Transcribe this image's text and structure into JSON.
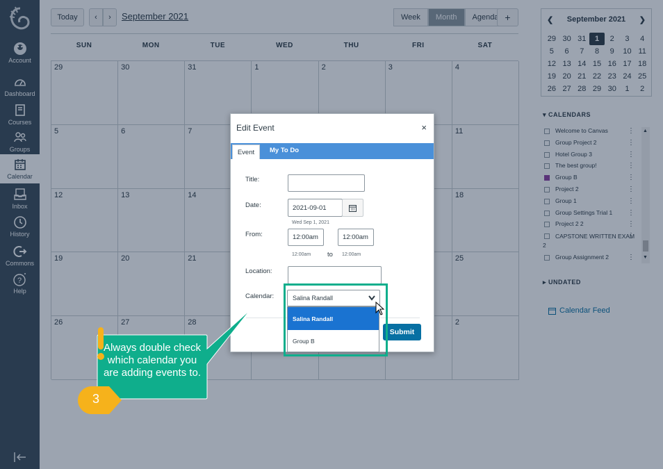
{
  "nav": {
    "items": [
      {
        "label": "Account",
        "icon": "account-icon"
      },
      {
        "label": "Dashboard",
        "icon": "dashboard-icon"
      },
      {
        "label": "Courses",
        "icon": "courses-icon"
      },
      {
        "label": "Groups",
        "icon": "groups-icon"
      },
      {
        "label": "Calendar",
        "icon": "calendar-icon"
      },
      {
        "label": "Inbox",
        "icon": "inbox-icon"
      },
      {
        "label": "History",
        "icon": "history-icon"
      },
      {
        "label": "Commons",
        "icon": "commons-icon"
      },
      {
        "label": "Help",
        "icon": "help-icon"
      }
    ]
  },
  "header": {
    "today_label": "Today",
    "month_title": "September 2021",
    "views": [
      "Week",
      "Month",
      "Agenda"
    ],
    "add_label": "+"
  },
  "calendar": {
    "weekdays": [
      "SUN",
      "MON",
      "TUE",
      "WED",
      "THU",
      "FRI",
      "SAT"
    ],
    "days": [
      "29",
      "30",
      "31",
      "1",
      "2",
      "3",
      "4",
      "5",
      "6",
      "7",
      "",
      "",
      "",
      "11",
      "12",
      "13",
      "14",
      "",
      "",
      "",
      "18",
      "19",
      "20",
      "21",
      "",
      "",
      "",
      "25",
      "26",
      "27",
      "28",
      "",
      "",
      "",
      "2"
    ]
  },
  "mini_cal": {
    "title": "September 2021",
    "rows": [
      [
        "29",
        "30",
        "31",
        "1",
        "2",
        "3",
        "4"
      ],
      [
        "5",
        "6",
        "7",
        "8",
        "9",
        "10",
        "11"
      ],
      [
        "12",
        "13",
        "14",
        "15",
        "16",
        "17",
        "18"
      ],
      [
        "19",
        "20",
        "21",
        "22",
        "23",
        "24",
        "25"
      ],
      [
        "26",
        "27",
        "28",
        "29",
        "30",
        "1",
        "2"
      ]
    ]
  },
  "sidebar": {
    "calendars_heading": "CALENDARS",
    "calendars": [
      "Welcome to Canvas",
      "Group Project 2",
      "Hotel Group 3",
      "The best group!",
      "Group B",
      "Project 2",
      "Group 1",
      "Group Settings Trial 1",
      "Project 2 2",
      "CAPSTONE WRITTEN EXAM 2",
      "Group Assignment 2"
    ],
    "undated_heading": "UNDATED",
    "calendar_feed": "Calendar Feed"
  },
  "modal": {
    "title": "Edit Event",
    "close": "×",
    "tabs": {
      "event": "Event",
      "todo": "My To Do"
    },
    "title_label": "Title:",
    "title_value": "",
    "date_label": "Date:",
    "date_value": "2021-09-01",
    "date_hint": "Wed Sep 1, 2021",
    "from_label": "From:",
    "from_value": "12:00am",
    "from_hint": "12:00am",
    "to_label": "to",
    "to_value": "12:00am",
    "to_hint": "12:00am",
    "location_label": "Location:",
    "location_value": "",
    "calendar_label": "Calendar:",
    "calendar_value": "Salina Randall",
    "calendar_options": [
      "Salina Randall",
      "Group B"
    ],
    "submit": "Submit"
  },
  "callout": {
    "text": "Always double check which calendar you are adding events to.",
    "step": "3",
    "color": "#0fae8c",
    "badge_color": "#f6b21b"
  }
}
